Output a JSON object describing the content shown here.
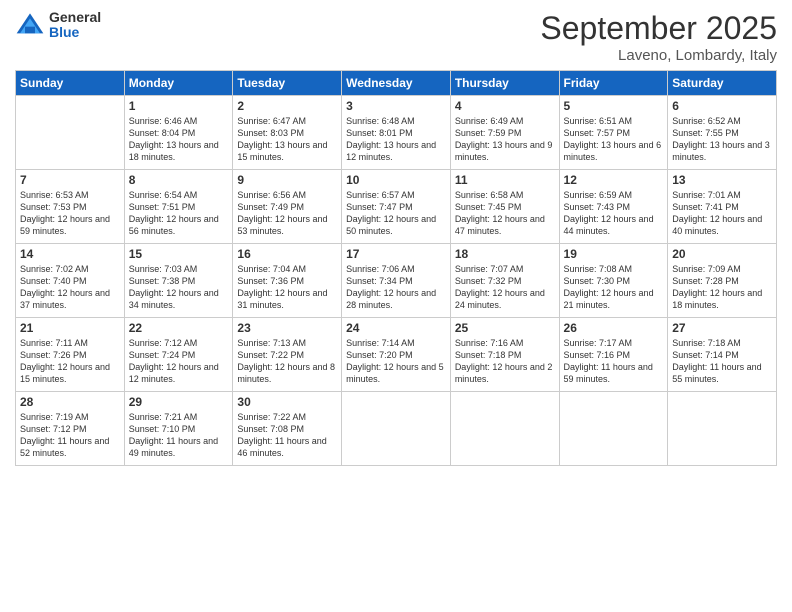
{
  "logo": {
    "general": "General",
    "blue": "Blue"
  },
  "title": "September 2025",
  "location": "Laveno, Lombardy, Italy",
  "days_of_week": [
    "Sunday",
    "Monday",
    "Tuesday",
    "Wednesday",
    "Thursday",
    "Friday",
    "Saturday"
  ],
  "weeks": [
    [
      {
        "day": "",
        "sunrise": "",
        "sunset": "",
        "daylight": ""
      },
      {
        "day": "1",
        "sunrise": "Sunrise: 6:46 AM",
        "sunset": "Sunset: 8:04 PM",
        "daylight": "Daylight: 13 hours and 18 minutes."
      },
      {
        "day": "2",
        "sunrise": "Sunrise: 6:47 AM",
        "sunset": "Sunset: 8:03 PM",
        "daylight": "Daylight: 13 hours and 15 minutes."
      },
      {
        "day": "3",
        "sunrise": "Sunrise: 6:48 AM",
        "sunset": "Sunset: 8:01 PM",
        "daylight": "Daylight: 13 hours and 12 minutes."
      },
      {
        "day": "4",
        "sunrise": "Sunrise: 6:49 AM",
        "sunset": "Sunset: 7:59 PM",
        "daylight": "Daylight: 13 hours and 9 minutes."
      },
      {
        "day": "5",
        "sunrise": "Sunrise: 6:51 AM",
        "sunset": "Sunset: 7:57 PM",
        "daylight": "Daylight: 13 hours and 6 minutes."
      },
      {
        "day": "6",
        "sunrise": "Sunrise: 6:52 AM",
        "sunset": "Sunset: 7:55 PM",
        "daylight": "Daylight: 13 hours and 3 minutes."
      }
    ],
    [
      {
        "day": "7",
        "sunrise": "Sunrise: 6:53 AM",
        "sunset": "Sunset: 7:53 PM",
        "daylight": "Daylight: 12 hours and 59 minutes."
      },
      {
        "day": "8",
        "sunrise": "Sunrise: 6:54 AM",
        "sunset": "Sunset: 7:51 PM",
        "daylight": "Daylight: 12 hours and 56 minutes."
      },
      {
        "day": "9",
        "sunrise": "Sunrise: 6:56 AM",
        "sunset": "Sunset: 7:49 PM",
        "daylight": "Daylight: 12 hours and 53 minutes."
      },
      {
        "day": "10",
        "sunrise": "Sunrise: 6:57 AM",
        "sunset": "Sunset: 7:47 PM",
        "daylight": "Daylight: 12 hours and 50 minutes."
      },
      {
        "day": "11",
        "sunrise": "Sunrise: 6:58 AM",
        "sunset": "Sunset: 7:45 PM",
        "daylight": "Daylight: 12 hours and 47 minutes."
      },
      {
        "day": "12",
        "sunrise": "Sunrise: 6:59 AM",
        "sunset": "Sunset: 7:43 PM",
        "daylight": "Daylight: 12 hours and 44 minutes."
      },
      {
        "day": "13",
        "sunrise": "Sunrise: 7:01 AM",
        "sunset": "Sunset: 7:41 PM",
        "daylight": "Daylight: 12 hours and 40 minutes."
      }
    ],
    [
      {
        "day": "14",
        "sunrise": "Sunrise: 7:02 AM",
        "sunset": "Sunset: 7:40 PM",
        "daylight": "Daylight: 12 hours and 37 minutes."
      },
      {
        "day": "15",
        "sunrise": "Sunrise: 7:03 AM",
        "sunset": "Sunset: 7:38 PM",
        "daylight": "Daylight: 12 hours and 34 minutes."
      },
      {
        "day": "16",
        "sunrise": "Sunrise: 7:04 AM",
        "sunset": "Sunset: 7:36 PM",
        "daylight": "Daylight: 12 hours and 31 minutes."
      },
      {
        "day": "17",
        "sunrise": "Sunrise: 7:06 AM",
        "sunset": "Sunset: 7:34 PM",
        "daylight": "Daylight: 12 hours and 28 minutes."
      },
      {
        "day": "18",
        "sunrise": "Sunrise: 7:07 AM",
        "sunset": "Sunset: 7:32 PM",
        "daylight": "Daylight: 12 hours and 24 minutes."
      },
      {
        "day": "19",
        "sunrise": "Sunrise: 7:08 AM",
        "sunset": "Sunset: 7:30 PM",
        "daylight": "Daylight: 12 hours and 21 minutes."
      },
      {
        "day": "20",
        "sunrise": "Sunrise: 7:09 AM",
        "sunset": "Sunset: 7:28 PM",
        "daylight": "Daylight: 12 hours and 18 minutes."
      }
    ],
    [
      {
        "day": "21",
        "sunrise": "Sunrise: 7:11 AM",
        "sunset": "Sunset: 7:26 PM",
        "daylight": "Daylight: 12 hours and 15 minutes."
      },
      {
        "day": "22",
        "sunrise": "Sunrise: 7:12 AM",
        "sunset": "Sunset: 7:24 PM",
        "daylight": "Daylight: 12 hours and 12 minutes."
      },
      {
        "day": "23",
        "sunrise": "Sunrise: 7:13 AM",
        "sunset": "Sunset: 7:22 PM",
        "daylight": "Daylight: 12 hours and 8 minutes."
      },
      {
        "day": "24",
        "sunrise": "Sunrise: 7:14 AM",
        "sunset": "Sunset: 7:20 PM",
        "daylight": "Daylight: 12 hours and 5 minutes."
      },
      {
        "day": "25",
        "sunrise": "Sunrise: 7:16 AM",
        "sunset": "Sunset: 7:18 PM",
        "daylight": "Daylight: 12 hours and 2 minutes."
      },
      {
        "day": "26",
        "sunrise": "Sunrise: 7:17 AM",
        "sunset": "Sunset: 7:16 PM",
        "daylight": "Daylight: 11 hours and 59 minutes."
      },
      {
        "day": "27",
        "sunrise": "Sunrise: 7:18 AM",
        "sunset": "Sunset: 7:14 PM",
        "daylight": "Daylight: 11 hours and 55 minutes."
      }
    ],
    [
      {
        "day": "28",
        "sunrise": "Sunrise: 7:19 AM",
        "sunset": "Sunset: 7:12 PM",
        "daylight": "Daylight: 11 hours and 52 minutes."
      },
      {
        "day": "29",
        "sunrise": "Sunrise: 7:21 AM",
        "sunset": "Sunset: 7:10 PM",
        "daylight": "Daylight: 11 hours and 49 minutes."
      },
      {
        "day": "30",
        "sunrise": "Sunrise: 7:22 AM",
        "sunset": "Sunset: 7:08 PM",
        "daylight": "Daylight: 11 hours and 46 minutes."
      },
      {
        "day": "",
        "sunrise": "",
        "sunset": "",
        "daylight": ""
      },
      {
        "day": "",
        "sunrise": "",
        "sunset": "",
        "daylight": ""
      },
      {
        "day": "",
        "sunrise": "",
        "sunset": "",
        "daylight": ""
      },
      {
        "day": "",
        "sunrise": "",
        "sunset": "",
        "daylight": ""
      }
    ]
  ]
}
